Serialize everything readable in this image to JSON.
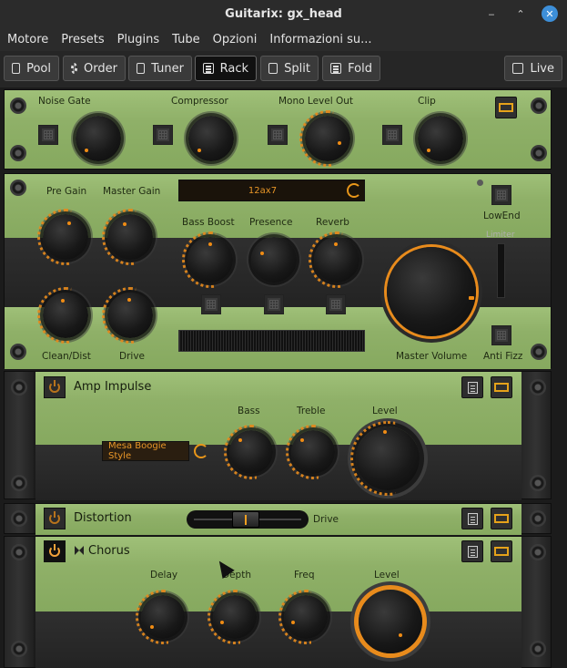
{
  "window": {
    "title": "Guitarix: gx_head"
  },
  "menubar": [
    "Motore",
    "Presets",
    "Plugins",
    "Tube",
    "Opzioni",
    "Informazioni su..."
  ],
  "toolbar": {
    "pool": "Pool",
    "order": "Order",
    "tuner": "Tuner",
    "rack": "Rack",
    "split": "Split",
    "fold": "Fold",
    "live": "Live"
  },
  "mono_strip": {
    "labels": [
      "Noise Gate",
      "Compressor",
      "Mono Level Out",
      "Clip"
    ]
  },
  "amp": {
    "pre_gain": "Pre Gain",
    "master_gain": "Master Gain",
    "tube": "12ax7",
    "bass_boost": "Bass Boost",
    "presence": "Presence",
    "reverb": "Reverb",
    "lowend": "LowEnd",
    "limiter": "Limiter",
    "clean_dist": "Clean/Dist",
    "drive": "Drive",
    "master_volume": "Master Volume",
    "anti_fizz": "Anti Fizz"
  },
  "amp_impulse": {
    "title": "Amp Impulse",
    "preset": "Mesa Boogie Style",
    "bass": "Bass",
    "treble": "Treble",
    "level": "Level"
  },
  "distortion": {
    "title": "Distortion",
    "drive": "Drive",
    "drive_level": 0.48
  },
  "chorus": {
    "title": "Chorus",
    "delay": "Delay",
    "depth": "Depth",
    "freq": "Freq",
    "level": "Level"
  },
  "colors": {
    "accent": "#e88b1c",
    "panel_green": "#8fb068",
    "background": "#1e1e1e"
  }
}
